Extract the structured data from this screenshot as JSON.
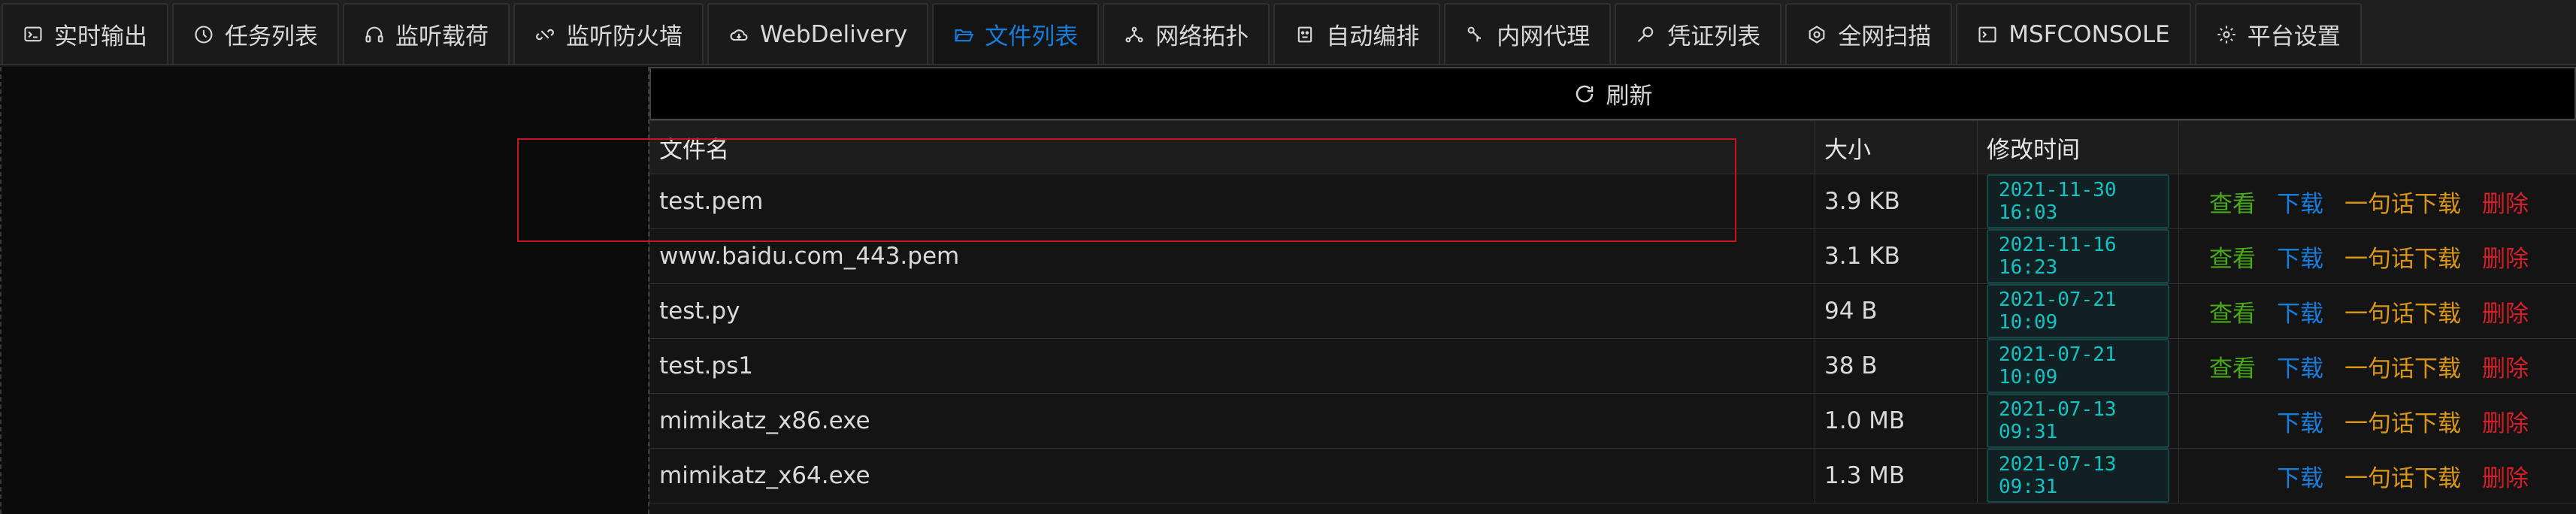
{
  "tabs": [
    {
      "label": "实时输出",
      "icon": "console-icon"
    },
    {
      "label": "任务列表",
      "icon": "clock-icon"
    },
    {
      "label": "监听载荷",
      "icon": "headphones-icon"
    },
    {
      "label": "监听防火墙",
      "icon": "link-broken-icon"
    },
    {
      "label": "WebDelivery",
      "icon": "cloud-icon"
    },
    {
      "label": "文件列表",
      "icon": "folder-open-icon",
      "active": true
    },
    {
      "label": "网络拓扑",
      "icon": "network-icon"
    },
    {
      "label": "自动编排",
      "icon": "robot-icon"
    },
    {
      "label": "内网代理",
      "icon": "proxy-icon"
    },
    {
      "label": "凭证列表",
      "icon": "key-icon"
    },
    {
      "label": "全网扫描",
      "icon": "radar-icon"
    },
    {
      "label": "MSFCONSOLE",
      "icon": "terminal-icon"
    },
    {
      "label": "平台设置",
      "icon": "gear-icon"
    }
  ],
  "refresh_label": "刷新",
  "columns": {
    "name": "文件名",
    "size": "大小",
    "time": "修改时间"
  },
  "actions": {
    "view": "查看",
    "download": "下载",
    "oneline": "一句话下载",
    "delete": "删除"
  },
  "files": [
    {
      "name": "test.pem",
      "size": "3.9 KB",
      "time": "2021-11-30 16:03",
      "viewable": true
    },
    {
      "name": "www.baidu.com_443.pem",
      "size": "3.1 KB",
      "time": "2021-11-16 16:23",
      "viewable": true
    },
    {
      "name": "test.py",
      "size": "94 B",
      "time": "2021-07-21 10:09",
      "viewable": true
    },
    {
      "name": "test.ps1",
      "size": "38 B",
      "time": "2021-07-21 10:09",
      "viewable": true
    },
    {
      "name": "mimikatz_x86.exe",
      "size": "1.0 MB",
      "time": "2021-07-13 09:31",
      "viewable": false
    },
    {
      "name": "mimikatz_x64.exe",
      "size": "1.3 MB",
      "time": "2021-07-13 09:31",
      "viewable": false
    }
  ],
  "colors": {
    "accent": "#177ddc",
    "view": "#49aa19",
    "oneline": "#d89614",
    "delete": "#d32029",
    "time_tag": "#13c2c2",
    "highlight": "#c8151d"
  }
}
